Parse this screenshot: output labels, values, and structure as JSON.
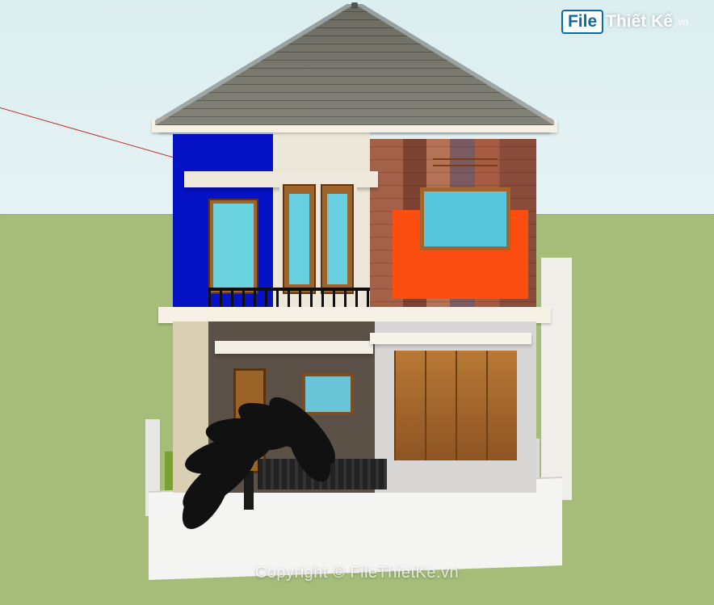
{
  "watermark": {
    "logo_box": "File",
    "logo_rest": "Thiết Kế",
    "logo_tld": ".vn",
    "copyright_text": "Copyright © FileThietKe.vn"
  },
  "scene": {
    "app_hint": "SketchUp viewport",
    "sky_color": "#dbeef0",
    "ground_color": "#a5bd79",
    "axis_line_color": "#c32f2f"
  },
  "house": {
    "storeys": 2,
    "roof": {
      "type": "hip",
      "material": "asphalt-shingle",
      "color": "#6b6b63"
    },
    "first_floor": {
      "accent_wall_color": "#0612c6",
      "brick_panel": true,
      "orange_panel_color": "#fc4e11",
      "balcony_railing": true,
      "window_count": 2,
      "door_count": 1
    },
    "ground_floor": {
      "front_gate_panels": 4,
      "small_window": true,
      "canopy_count": 2,
      "entry_door": true
    },
    "site": {
      "lawn": true,
      "driveway_paving": "grid",
      "plant": "palm",
      "compound_wall": true
    }
  }
}
